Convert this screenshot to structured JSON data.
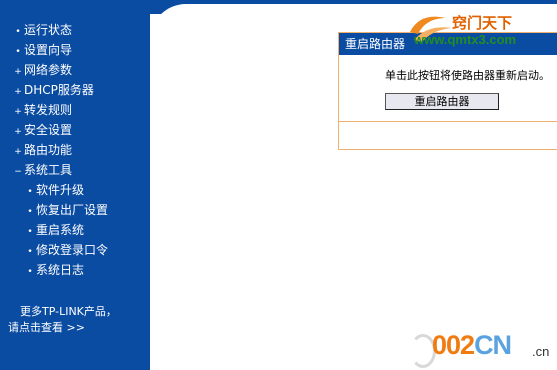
{
  "sidebar": {
    "items": [
      {
        "bullet": "•",
        "label": "运行状态",
        "level": 1
      },
      {
        "bullet": "•",
        "label": "设置向导",
        "level": 1
      },
      {
        "bullet": "+",
        "label": "网络参数",
        "level": 1
      },
      {
        "bullet": "+",
        "label": "DHCP服务器",
        "level": 1
      },
      {
        "bullet": "+",
        "label": "转发规则",
        "level": 1
      },
      {
        "bullet": "+",
        "label": "安全设置",
        "level": 1
      },
      {
        "bullet": "+",
        "label": "路由功能",
        "level": 1
      },
      {
        "bullet": "−",
        "label": "系统工具",
        "level": 1
      },
      {
        "bullet": "•",
        "label": "软件升级",
        "level": 2
      },
      {
        "bullet": "•",
        "label": "恢复出厂设置",
        "level": 2
      },
      {
        "bullet": "•",
        "label": "重启系统",
        "level": 2
      },
      {
        "bullet": "•",
        "label": "修改登录口令",
        "level": 2
      },
      {
        "bullet": "•",
        "label": "系统日志",
        "level": 2
      }
    ],
    "footer_line1": "更多TP-LINK产品，",
    "footer_line2": "请点击查看 >>"
  },
  "panel": {
    "title": "重启路由器",
    "message": "单击此按钮将使路由器重新启动。",
    "button_label": "重启路由器"
  },
  "watermark_top": {
    "cn": "窍门天下",
    "url": "www.qmtx3.com"
  },
  "watermark_bottom": {
    "digits": "002",
    "letters": "CN",
    "tld": ".cn"
  },
  "colors": {
    "sidebar_blue": "#0b4ca3",
    "panel_border": "#f0b070"
  }
}
